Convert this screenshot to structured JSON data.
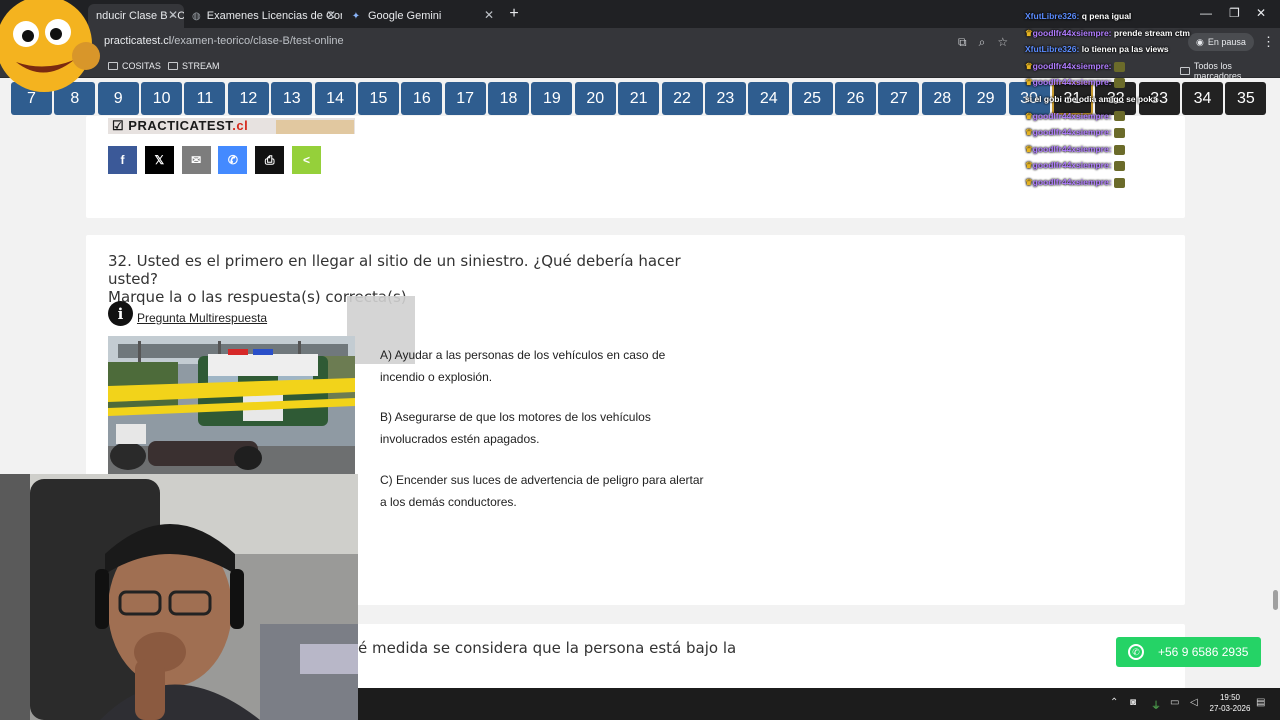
{
  "browser": {
    "tabs": [
      {
        "title": "nducir Clase B - C",
        "active": true
      },
      {
        "title": "Examenes Licencias de Conducc",
        "active": false
      },
      {
        "title": "Google Gemini",
        "active": false
      }
    ],
    "url_domain": "practicatest.cl",
    "url_path": "/examen-teorico/clase-B/test-online",
    "pause_label": "En pausa",
    "bookmarks": [
      "COSITAS",
      "STREAM"
    ],
    "bookmarks_right": "Todos los marcadores"
  },
  "question_nav": {
    "numbers": [
      "7",
      "8",
      "9",
      "10",
      "11",
      "12",
      "13",
      "14",
      "15",
      "16",
      "17",
      "18",
      "19",
      "20",
      "21",
      "22",
      "23",
      "24",
      "25",
      "26",
      "27",
      "28",
      "29",
      "30",
      "31",
      "32",
      "33",
      "34",
      "35"
    ],
    "current": "31"
  },
  "logo": {
    "text": "PRACTICATEST",
    "suffix": ".cl"
  },
  "share_buttons": [
    {
      "name": "facebook",
      "glyph": "f",
      "color": "#3b5998"
    },
    {
      "name": "x",
      "glyph": "𝕏",
      "color": "#000000"
    },
    {
      "name": "email",
      "glyph": "✉",
      "color": "#7d7d7d"
    },
    {
      "name": "messenger",
      "glyph": "✆",
      "color": "#448aff"
    },
    {
      "name": "print",
      "glyph": "⎙",
      "color": "#111111"
    },
    {
      "name": "sharethis",
      "glyph": "<",
      "color": "#95d03a"
    }
  ],
  "question": {
    "title_line1": "32. Usted es el primero en llegar al sitio de un siniestro. ¿Qué debería hacer usted?",
    "title_line2": "Marque la o las respuesta(s) correcta(s)",
    "type_label": "Pregunta Multirespuesta",
    "options": [
      "A) Ayudar a las personas de los vehículos en caso de incendio o explosión.",
      "B) Asegurarse de que los motores de los vehículos involucrados estén apagados.",
      "C) Encender sus luces de advertencia de peligro para alertar a los demás conductores."
    ]
  },
  "next_question_partial": "é medida se considera que la persona está bajo la",
  "whatsapp": {
    "number": "+56 9 6586 2935"
  },
  "chat": [
    {
      "user": "XfutLibre326:",
      "msg": "q pena igual",
      "kind": "a"
    },
    {
      "user": "goodlfr44xsiempre:",
      "msg": "prende stream ctm",
      "kind": "b"
    },
    {
      "user": "XfutLibre326:",
      "msg": "lo tienen pa las views",
      "kind": "a"
    },
    {
      "user": "goodlfr44xsiempre:",
      "msg": "",
      "kind": "b",
      "emote": true
    },
    {
      "user": "goodlfr44xsiempre:",
      "msg": "",
      "kind": "b",
      "emote": true
    },
    {
      "user": "",
      "msg": "si el gobi me odia amigo se poka",
      "kind": "a"
    },
    {
      "user": "goodlfr44xsiempre:",
      "msg": "",
      "kind": "b",
      "emote": true
    },
    {
      "user": "goodlfr44xsiempre:",
      "msg": "",
      "kind": "b",
      "emote": true
    },
    {
      "user": "goodlfr44xsiempre:",
      "msg": "",
      "kind": "b",
      "emote": true
    },
    {
      "user": "goodlfr44xsiempre:",
      "msg": "",
      "kind": "b",
      "emote": true
    },
    {
      "user": "goodlfr44xsiempre:",
      "msg": "",
      "kind": "b",
      "emote": true
    }
  ],
  "clock": {
    "time": "19:50",
    "date": "27-03-2026"
  }
}
